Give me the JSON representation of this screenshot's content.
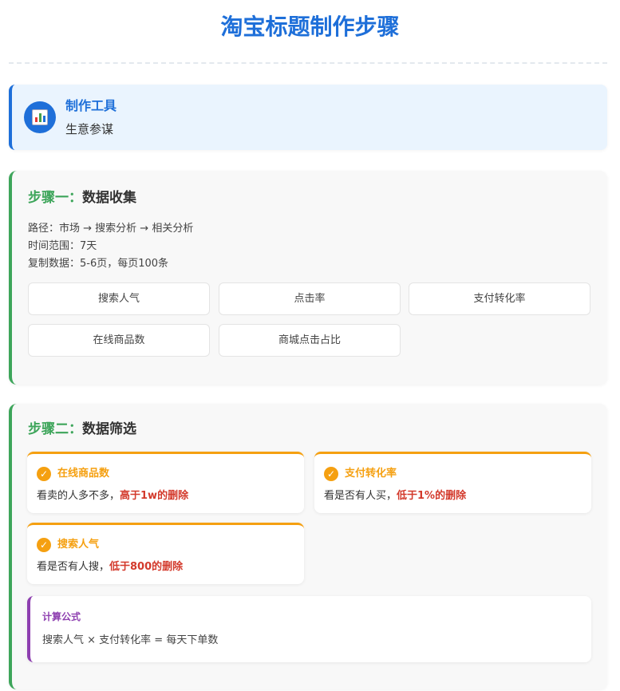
{
  "page_title": "淘宝标题制作步骤",
  "tool": {
    "icon": "bar-chart-icon",
    "label": "制作工具",
    "value": "生意参谋"
  },
  "step1": {
    "prefix": "步骤一：",
    "name": "数据收集",
    "info": [
      "路径：市场 → 搜索分析 → 相关分析",
      "时间范围：7天",
      "复制数据：5-6页，每页100条"
    ],
    "metrics": [
      "搜索人气",
      "点击率",
      "支付转化率",
      "在线商品数",
      "商城点击占比"
    ]
  },
  "step2": {
    "prefix": "步骤二：",
    "name": "数据筛选",
    "filters": [
      {
        "title": "在线商品数",
        "desc": "看卖的人多不多，",
        "highlight": "高于1w的删除"
      },
      {
        "title": "支付转化率",
        "desc": "看是否有人买，",
        "highlight": "低于1%的删除"
      },
      {
        "title": "搜索人气",
        "desc": "看是否有人搜，",
        "highlight": "低于800的删除"
      }
    ],
    "formula": {
      "label": "计算公式",
      "text": "搜索人气 × 支付转化率 = 每天下单数"
    }
  },
  "colors": {
    "title_blue": "#1e6fd9",
    "step_green": "#3da55a",
    "filter_orange": "#f5a011",
    "highlight_red": "#d33a2c",
    "formula_purple": "#8e3fb0"
  }
}
